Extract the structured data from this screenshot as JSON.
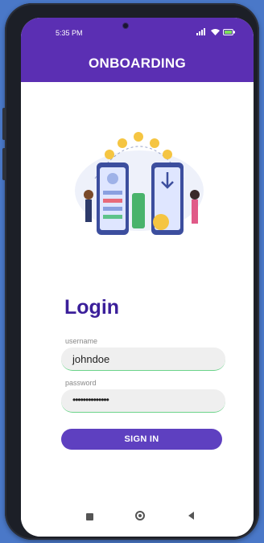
{
  "status": {
    "time": "5:35 PM",
    "right_text": "..ıl ᵛᵒ ≈ ▭⚡"
  },
  "appbar": {
    "title": "ONBOARDING"
  },
  "login": {
    "title": "Login",
    "username_label": "username",
    "username_value": "johndoe",
    "password_label": "password",
    "password_dots": "••••••••••••••",
    "signin_label": "SIGN IN"
  },
  "colors": {
    "accent": "#5b2fb3",
    "button": "#5e40c0",
    "title": "#3b1f9a"
  },
  "icons": [
    "camera-icon",
    "signal-icon",
    "wifi-icon",
    "battery-icon",
    "recents-icon",
    "home-icon",
    "back-icon"
  ]
}
